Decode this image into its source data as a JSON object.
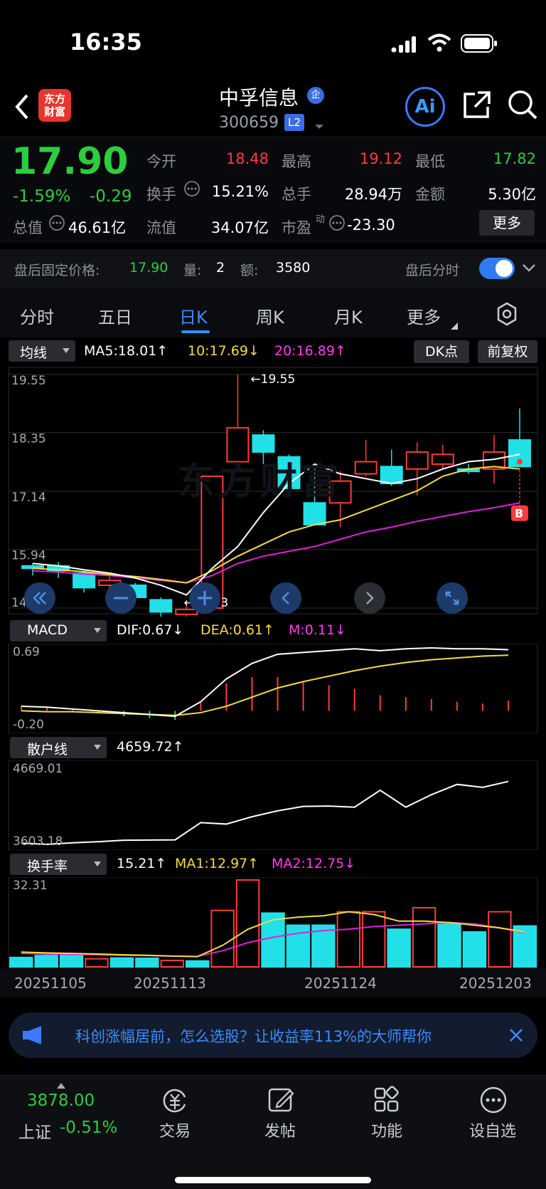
{
  "status_bar": {
    "time": "16:35"
  },
  "header": {
    "logo_line1": "东方",
    "logo_line2": "财富",
    "stock_name": "中孚信息",
    "badge": "企",
    "stock_code": "300659",
    "level": "L2",
    "ai_label": "Ai"
  },
  "quote": {
    "price": "17.90",
    "change_pct": "-1.59%",
    "change": "-0.29",
    "fields": {
      "open_label": "今开",
      "open": "18.48",
      "high_label": "最高",
      "high": "19.12",
      "low_label": "最低",
      "low": "17.82",
      "turnover_label": "换手",
      "turnover": "15.21%",
      "volume_label": "总手",
      "volume": "28.94万",
      "amount_label": "金额",
      "amount": "5.30亿",
      "mktcap_label": "总值",
      "mktcap": "46.61亿",
      "float_label": "流值",
      "float": "34.07亿",
      "pe_label": "市盈",
      "pe_sup": "动",
      "pe": "-23.30"
    },
    "more_button": "更多"
  },
  "after_hours": {
    "label": "盘后固定价格:",
    "price": "17.90",
    "vol_label": "量:",
    "vol": "2",
    "amt_label": "额:",
    "amt": "3580",
    "toggle_label": "盘后分时"
  },
  "tabs": [
    {
      "label": "分时"
    },
    {
      "label": "五日"
    },
    {
      "label": "日K"
    },
    {
      "label": "周K"
    },
    {
      "label": "月K"
    },
    {
      "label": "更多"
    }
  ],
  "ma_bar": {
    "selector": "均线",
    "ma5": "MA5:18.01↑",
    "ma10": "10:17.69↓",
    "ma20": "20:16.89↑",
    "dk_button": "DK点",
    "adjust_button": "前复权"
  },
  "macd_bar": {
    "selector": "MACD",
    "dif": "DIF:0.67↓",
    "dea": "DEA:0.61↑",
    "m": "M:0.11↓",
    "top": "0.69",
    "bottom": "-0.20"
  },
  "retail_bar": {
    "selector": "散户线",
    "value": "4659.72↑",
    "top": "4669.01",
    "bottom": "3603.18"
  },
  "turnover_bar": {
    "selector": "换手率",
    "value": "15.21↑",
    "ma1": "MA1:12.97↑",
    "ma2": "MA2:12.75↓",
    "top": "32.31"
  },
  "dates": [
    "20251105",
    "20251113",
    "20251124",
    "20251203"
  ],
  "banner": {
    "text": "科创涨幅居前，怎么选股？让收益率113%的大师帮你"
  },
  "bottom_nav": {
    "index_value": "3878.00",
    "index_name": "上证",
    "index_change": "-0.51%",
    "trade": "交易",
    "post": "发帖",
    "func": "功能",
    "watch": "设自选"
  },
  "colors": {
    "up": "#ff3b3b",
    "down": "#22e0e8",
    "accent": "#3a7bff",
    "ma10": "#f5dc3c",
    "ma20": "#e020d8"
  },
  "chart_data": {
    "type": "candlestick",
    "y_ticks": [
      "19.55",
      "18.35",
      "17.14",
      "15.94",
      "14.73"
    ],
    "ylim": [
      14.73,
      19.55
    ],
    "high_label": "←19.55",
    "low_label": "←14.73",
    "candles": [
      {
        "o": 15.6,
        "c": 15.55,
        "h": 15.65,
        "l": 15.4
      },
      {
        "o": 15.6,
        "c": 15.5,
        "h": 15.68,
        "l": 15.35
      },
      {
        "o": 15.45,
        "c": 15.15,
        "h": 15.5,
        "l": 15.05
      },
      {
        "o": 15.2,
        "c": 15.3,
        "h": 15.4,
        "l": 15.1
      },
      {
        "o": 15.2,
        "c": 14.95,
        "h": 15.25,
        "l": 14.85
      },
      {
        "o": 14.9,
        "c": 14.65,
        "h": 14.95,
        "l": 14.55
      },
      {
        "o": 14.6,
        "c": 14.7,
        "h": 14.85,
        "l": 14.5
      },
      {
        "o": 14.73,
        "c": 17.45,
        "h": 17.45,
        "l": 14.73
      },
      {
        "o": 17.75,
        "c": 18.45,
        "h": 19.55,
        "l": 17.75
      },
      {
        "o": 18.3,
        "c": 17.95,
        "h": 18.4,
        "l": 17.4
      },
      {
        "o": 17.85,
        "c": 17.2,
        "h": 17.9,
        "l": 17.1
      },
      {
        "o": 16.9,
        "c": 16.45,
        "h": 17.7,
        "l": 16.45
      },
      {
        "o": 16.9,
        "c": 17.35,
        "h": 17.55,
        "l": 16.4
      },
      {
        "o": 17.5,
        "c": 17.75,
        "h": 18.2,
        "l": 17.45
      },
      {
        "o": 17.65,
        "c": 17.3,
        "h": 18.0,
        "l": 17.25
      },
      {
        "o": 17.6,
        "c": 17.95,
        "h": 18.15,
        "l": 17.05
      },
      {
        "o": 17.7,
        "c": 17.9,
        "h": 18.1,
        "l": 17.6
      },
      {
        "o": 17.6,
        "c": 17.55,
        "h": 17.7,
        "l": 17.5
      },
      {
        "o": 17.6,
        "c": 17.95,
        "h": 18.3,
        "l": 17.3
      },
      {
        "o": 18.2,
        "c": 17.65,
        "h": 18.85,
        "l": 17.65
      }
    ],
    "ma5": [
      15.65,
      15.6,
      15.52,
      15.45,
      15.35,
      15.2,
      15.0,
      15.55,
      16.0,
      16.7,
      17.3,
      17.7,
      17.5,
      17.4,
      17.3,
      17.4,
      17.6,
      17.75,
      17.8,
      17.9
    ],
    "ma10": [
      15.55,
      15.52,
      15.48,
      15.42,
      15.38,
      15.32,
      15.25,
      15.5,
      15.8,
      16.05,
      16.3,
      16.45,
      16.55,
      16.75,
      16.95,
      17.15,
      17.45,
      17.6,
      17.65,
      17.6
    ],
    "ma20": [
      15.5,
      15.47,
      15.43,
      15.4,
      15.35,
      15.3,
      15.25,
      15.4,
      15.65,
      15.8,
      15.9,
      16.0,
      16.15,
      16.3,
      16.4,
      16.52,
      16.62,
      16.72,
      16.8,
      16.9
    ],
    "macd": {
      "dif": [
        0.05,
        0.04,
        0.02,
        0.0,
        -0.02,
        -0.04,
        -0.06,
        0.1,
        0.35,
        0.52,
        0.62,
        0.64,
        0.66,
        0.68,
        0.66,
        0.68,
        0.69,
        0.68,
        0.68,
        0.67
      ],
      "dea": [
        0.0,
        -0.01,
        -0.01,
        -0.02,
        -0.03,
        -0.04,
        -0.05,
        -0.02,
        0.05,
        0.15,
        0.25,
        0.32,
        0.38,
        0.44,
        0.49,
        0.53,
        0.56,
        0.58,
        0.6,
        0.61
      ],
      "m": [
        0.05,
        0.04,
        0.01,
        -0.03,
        -0.06,
        -0.08,
        -0.1,
        0.09,
        0.3,
        0.37,
        0.37,
        0.32,
        0.28,
        0.24,
        0.17,
        0.15,
        0.13,
        0.1,
        0.08,
        0.11
      ],
      "ylim": [
        -0.2,
        0.69
      ]
    },
    "retail": {
      "values": [
        3620,
        3605,
        3625,
        3640,
        3660,
        3663,
        3665,
        3900,
        3880,
        3980,
        4060,
        4120,
        4125,
        4110,
        4340,
        4110,
        4280,
        4420,
        4380,
        4460
      ],
      "ylim": [
        3603.18,
        4669.01
      ]
    },
    "turnover": {
      "values": [
        3.5,
        4.2,
        4.5,
        3.0,
        3.3,
        3.2,
        2.4,
        2.2,
        21.0,
        32.31,
        20.0,
        15.5,
        15.5,
        20.5,
        20.5,
        14.0,
        22.0,
        16.0,
        13.0,
        20.5,
        15.21
      ],
      "ma1": [
        5.5,
        5.2,
        5.0,
        4.8,
        4.5,
        4.3,
        4.0,
        3.8,
        8.0,
        14.0,
        17.5,
        18.5,
        19.0,
        20.5,
        19.5,
        17.0,
        17.0,
        16.5,
        15.5,
        14.5,
        12.97
      ],
      "ma2": [
        5.0,
        4.8,
        4.6,
        4.5,
        4.3,
        4.2,
        4.0,
        3.9,
        6.0,
        9.0,
        11.0,
        12.5,
        13.5,
        14.0,
        15.0,
        15.5,
        16.0,
        16.5,
        16.0,
        14.5,
        12.75
      ],
      "ylim": [
        0,
        32.31
      ]
    }
  }
}
